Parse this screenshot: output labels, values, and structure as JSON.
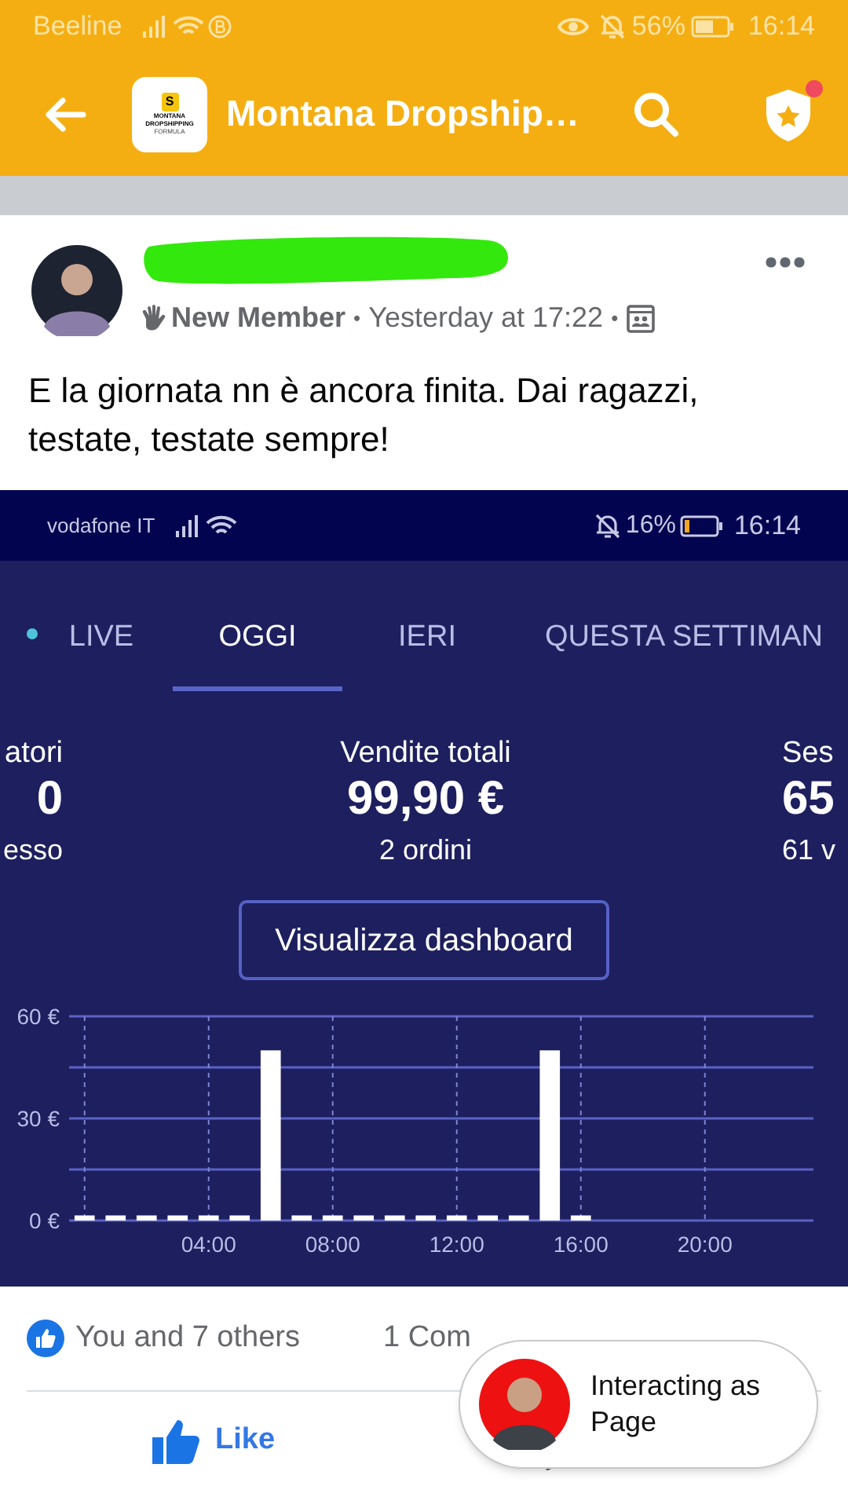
{
  "status_bar": {
    "carrier": "Beeline",
    "battery": "56%",
    "time": "16:14"
  },
  "app_bar": {
    "logo_texts": [
      "MONTANA",
      "DROPSHIPPING",
      "FORMULA"
    ],
    "logo_mark": "S",
    "title": "Montana Dropship…",
    "has_notification": true
  },
  "post": {
    "author_hidden": true,
    "badge": "New Member",
    "time": "Yesterday at 17:22",
    "separator": "•",
    "text": "E la giornata nn è ancora finita. Dai ragazzi, testate, testate sempre!",
    "screenshot": {
      "status_bar": {
        "carrier": "vodafone IT",
        "battery": "16%",
        "time": "16:14"
      },
      "tabs": [
        {
          "label": "LIVE",
          "live": true,
          "selected": false
        },
        {
          "label": "OGGI",
          "live": false,
          "selected": true
        },
        {
          "label": "IERI",
          "live": false,
          "selected": false
        },
        {
          "label": "QUESTA SETTIMAN",
          "live": false,
          "selected": false
        }
      ],
      "stats": [
        {
          "label": "atori",
          "value": "0",
          "sub": "esso"
        },
        {
          "label": "Vendite totali",
          "value": "99,90 €",
          "sub": "2 ordini"
        },
        {
          "label": "Ses",
          "value": "65",
          "sub": "61 v"
        }
      ],
      "button": "Visualizza dashboard",
      "chart_data": {
        "type": "bar",
        "x": [
          0,
          1,
          2,
          3,
          4,
          5,
          6,
          7,
          8,
          9,
          10,
          11,
          12,
          13,
          14,
          15,
          16,
          17,
          18,
          19,
          20,
          21,
          22,
          23
        ],
        "series": [
          {
            "color": "#ffffff",
            "values": [
              1.5,
              1.5,
              1.5,
              1.5,
              1.5,
              1.5,
              50,
              1.5,
              1.5,
              1.5,
              1.5,
              1.5,
              1.5,
              1.5,
              1.5,
              50,
              1.5,
              0,
              0,
              0,
              0,
              0,
              0,
              0
            ]
          }
        ],
        "xlim": [
          -0.5,
          23.5
        ],
        "ylim": [
          0,
          60
        ],
        "grid": true,
        "ref_lines": [
          {
            "axis": "y",
            "value": 15
          },
          {
            "axis": "y",
            "value": 30
          },
          {
            "axis": "y",
            "value": 45
          }
        ],
        "yticks": [
          {
            "value": 0,
            "label": "0 €"
          },
          {
            "value": 30,
            "label": "30 €"
          },
          {
            "value": 60,
            "label": "60 €"
          }
        ],
        "xticks": [
          {
            "value": 4,
            "label": "04:00"
          },
          {
            "value": 8,
            "label": "08:00"
          },
          {
            "value": 12,
            "label": "12:00"
          },
          {
            "value": 16,
            "label": "16:00"
          },
          {
            "value": 20,
            "label": "20:00"
          }
        ]
      }
    },
    "reactions": "You and 7 others",
    "comments": "1 Com",
    "like": "Like"
  },
  "popup": {
    "text": "Interacting as Page"
  }
}
